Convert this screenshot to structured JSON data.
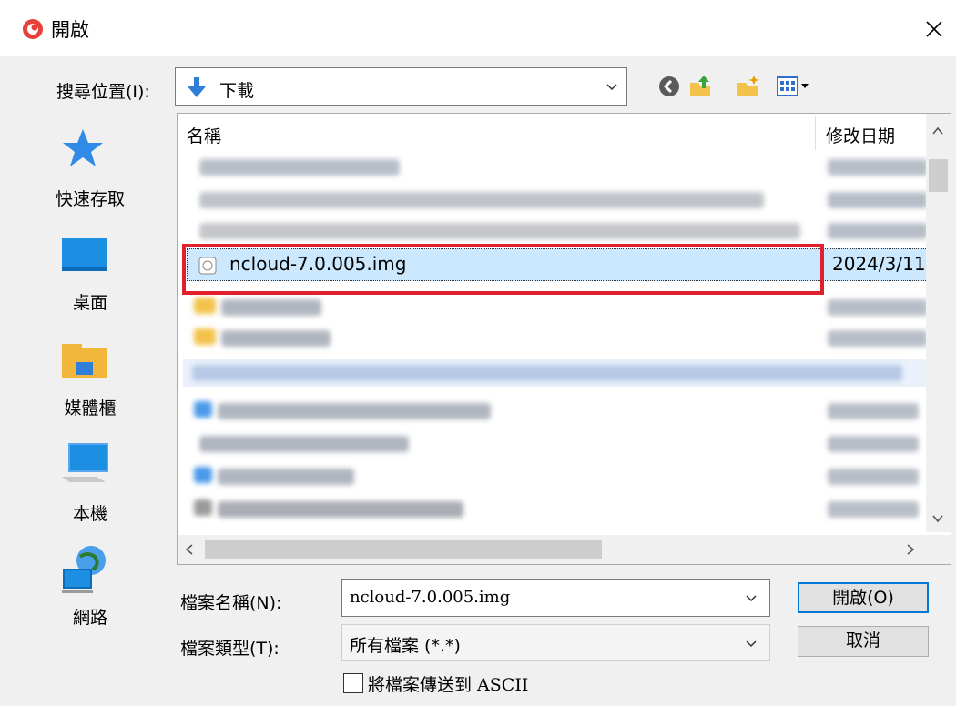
{
  "window": {
    "title": "開啟",
    "close_glyph": "✕"
  },
  "lookin": {
    "label": "搜尋位置(I):",
    "folder": "下載"
  },
  "toolbar": {
    "icons": [
      "back-icon",
      "up-folder-icon",
      "new-folder-icon",
      "view-menu-icon"
    ]
  },
  "places": [
    {
      "label": "快速存取",
      "icon": "star-icon"
    },
    {
      "label": "桌面",
      "icon": "desktop-icon"
    },
    {
      "label": "媒體櫃",
      "icon": "library-icon"
    },
    {
      "label": "本機",
      "icon": "computer-icon"
    },
    {
      "label": "網路",
      "icon": "network-icon"
    }
  ],
  "filelist": {
    "columns": {
      "name": "名稱",
      "date": "修改日期"
    },
    "selected": {
      "name": "ncloud-7.0.005.img",
      "date": "2024/3/11"
    }
  },
  "filename": {
    "label": "檔案名稱(N):",
    "value": "ncloud-7.0.005.img"
  },
  "filetype": {
    "label": "檔案類型(T):",
    "value": "所有檔案 (*.*)"
  },
  "buttons": {
    "open": "開啟(O)",
    "cancel": "取消"
  },
  "ascii": {
    "label": "將檔案傳送到 ASCII",
    "checked": false
  },
  "colors": {
    "accent": "#0078d7",
    "highlight_border": "#e0202c",
    "selection": "#cce8ff"
  }
}
